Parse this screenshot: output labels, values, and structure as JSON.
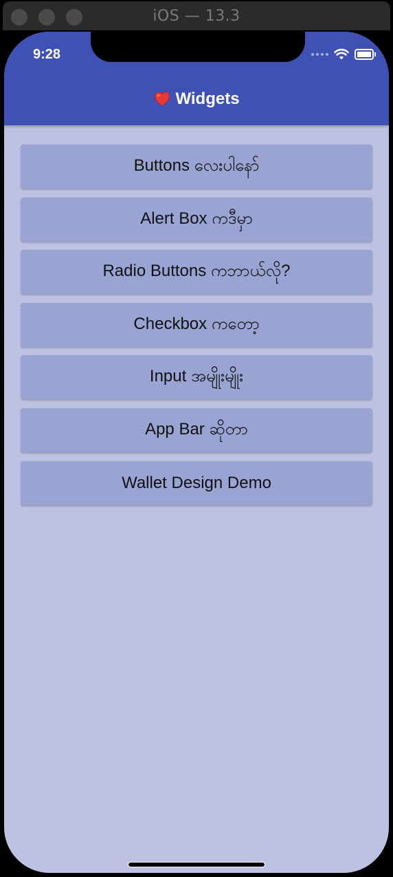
{
  "window": {
    "title": "iOS — 13.3"
  },
  "status_bar": {
    "time": "9:28",
    "icons": [
      "signal-icon",
      "wifi-icon",
      "battery-icon"
    ]
  },
  "app_bar": {
    "icon": "heart-icon",
    "title": "Widgets",
    "color": "#3f51b5"
  },
  "menu": {
    "items": [
      {
        "label": "Buttons လေးပါနော်"
      },
      {
        "label": "Alert Box ကဒီမှာ"
      },
      {
        "label": "Radio Buttons ကဘာယ်လို?"
      },
      {
        "label": "Checkbox ကတော့"
      },
      {
        "label": "Input အမျိုးမျိုး"
      },
      {
        "label": "App Bar ဆိုတာ"
      },
      {
        "label": "Wallet Design Demo"
      }
    ]
  },
  "colors": {
    "background": "#bec2e2",
    "button": "#9aa4d3",
    "heart": "#e53935"
  }
}
